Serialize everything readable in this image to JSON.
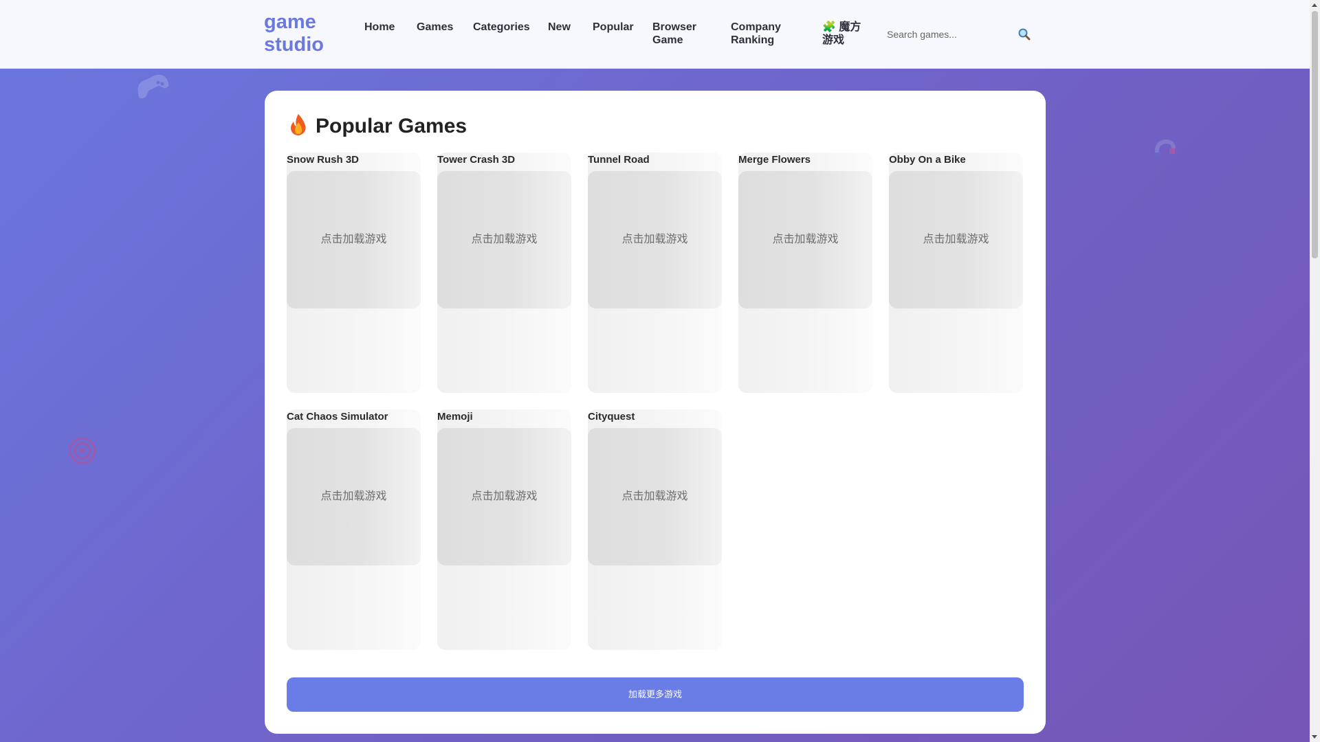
{
  "header": {
    "logo": "game studio",
    "nav": [
      {
        "label": "Home"
      },
      {
        "label": "Games"
      },
      {
        "label": "Categories"
      },
      {
        "label": "New"
      },
      {
        "label": "Popular"
      },
      {
        "label": "Browser Game"
      },
      {
        "label": "Company Ranking"
      },
      {
        "label": "🧩 魔方游戏"
      }
    ],
    "search": {
      "placeholder": "Search games...",
      "value": "",
      "icon": "search-icon"
    }
  },
  "section": {
    "title": "Popular Games",
    "icon": "fire-icon"
  },
  "games": [
    {
      "title": "Snow Rush 3D",
      "thumb_label": "点击加载游戏"
    },
    {
      "title": "Tower Crash 3D",
      "thumb_label": "点击加载游戏"
    },
    {
      "title": "Tunnel Road",
      "thumb_label": "点击加载游戏"
    },
    {
      "title": "Merge Flowers",
      "thumb_label": "点击加载游戏"
    },
    {
      "title": "Obby On a Bike",
      "thumb_label": "点击加载游戏"
    },
    {
      "title": "Cat Chaos Simulator",
      "thumb_label": "点击加载游戏"
    },
    {
      "title": "Memoji",
      "thumb_label": "点击加载游戏"
    },
    {
      "title": "Cityquest",
      "thumb_label": "点击加载游戏"
    }
  ],
  "load_more": {
    "label": "加载更多游戏"
  },
  "colors": {
    "accent": "#6a78e0",
    "button": "#6a7ce6",
    "card_bg": "#ffffff"
  }
}
